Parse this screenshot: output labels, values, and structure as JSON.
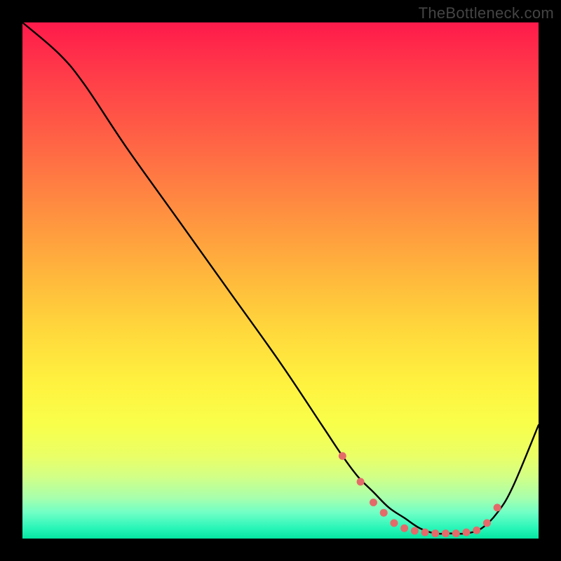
{
  "watermark": "TheBottleneck.com",
  "chart_data": {
    "type": "line",
    "title": "",
    "xlabel": "",
    "ylabel": "",
    "xlim": [
      0,
      100
    ],
    "ylim": [
      0,
      100
    ],
    "series": [
      {
        "name": "curve",
        "x": [
          0,
          7,
          12,
          20,
          30,
          40,
          50,
          58,
          62,
          65,
          68,
          71,
          74,
          77,
          80,
          83,
          86,
          89,
          92,
          95,
          100
        ],
        "y": [
          100,
          94,
          88,
          76,
          62,
          48,
          34,
          22,
          16,
          12,
          9,
          6,
          4,
          2,
          1,
          1,
          1,
          2,
          5,
          10,
          22
        ]
      }
    ],
    "markers": {
      "name": "dots",
      "x": [
        62,
        65.5,
        68,
        70,
        72,
        74,
        76,
        78,
        80,
        82,
        84,
        86,
        88,
        90,
        92
      ],
      "y": [
        16,
        11,
        7,
        5,
        3,
        2,
        1.5,
        1.2,
        1.0,
        1.0,
        1.0,
        1.2,
        1.6,
        3,
        6
      ]
    },
    "colors": {
      "curve": "#000000",
      "dots": "#e46a6a"
    }
  }
}
